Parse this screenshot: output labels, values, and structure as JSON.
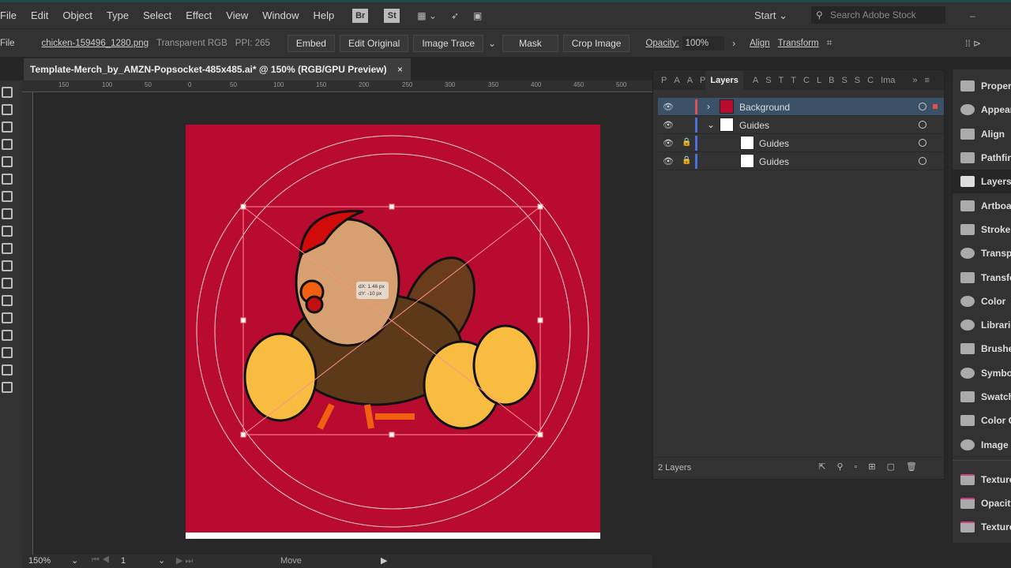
{
  "menu": [
    "File",
    "Edit",
    "Object",
    "Type",
    "Select",
    "Effect",
    "View",
    "Window",
    "Help"
  ],
  "app_icons": [
    "Br",
    "St"
  ],
  "workspace": "Start",
  "search_placeholder": "Search Adobe Stock",
  "control": {
    "file_label": "File",
    "filename": "chicken-159496_1280.png",
    "color_mode": "Transparent RGB",
    "ppi": "PPI: 265",
    "buttons": [
      "Embed",
      "Edit Original",
      "Image Trace",
      "Mask",
      "Crop Image"
    ],
    "opacity_label": "Opacity:",
    "opacity_value": "100%",
    "align": "Align",
    "transform": "Transform"
  },
  "document_tab": {
    "title": "Template-Merch_by_AMZN-Popsocket-485x485.ai* @ 150% (RGB/GPU Preview)",
    "close": "×"
  },
  "ruler_labels": [
    "150",
    "100",
    "50",
    "0",
    "50",
    "100",
    "150",
    "200",
    "250",
    "300",
    "350",
    "400",
    "450",
    "500"
  ],
  "tooltip": {
    "dx": "dX: 1.46 px",
    "dy": "dY: -10 px"
  },
  "colors": {
    "artboard": "#b90b30",
    "selection": "#3b5168"
  },
  "layers_panel": {
    "tabs_before": [
      "P",
      "A",
      "A",
      "P"
    ],
    "active_tab": "Layers",
    "tabs_after": [
      "A",
      "S",
      "T",
      "T",
      "C",
      "L",
      "B",
      "S",
      "S",
      "C",
      "Ima"
    ],
    "rows": [
      {
        "name": "Background",
        "color": "#e05050",
        "expanded": false,
        "locked": false,
        "selected": true
      },
      {
        "name": "Guides",
        "color": "#4a6fd8",
        "expanded": true,
        "locked": false,
        "selected": false
      },
      {
        "name": "Guides",
        "color": "#4a6fd8",
        "locked": true,
        "sub": true
      },
      {
        "name": "Guides",
        "color": "#4a6fd8",
        "locked": true,
        "sub": true
      }
    ],
    "footer": "2 Layers"
  },
  "dock": [
    "Properties",
    "Appearance",
    "Align",
    "Pathfinder",
    "Layers",
    "Artboards",
    "Stroke",
    "Transparency",
    "Transform",
    "Color",
    "Libraries",
    "Brushes",
    "Symbols",
    "Swatches",
    "Color Guide",
    "Image Trace",
    "Texture",
    "Opacity",
    "Texture"
  ],
  "status": {
    "zoom": "150%",
    "artboard": "1",
    "tool": "Move"
  }
}
